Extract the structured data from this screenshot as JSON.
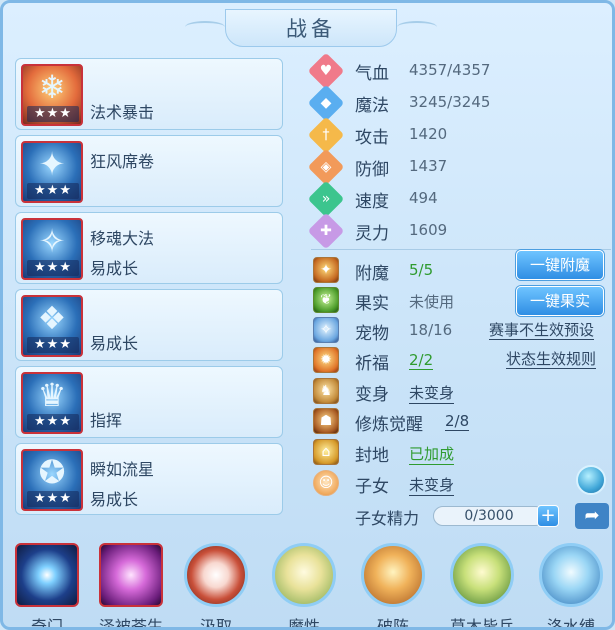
{
  "title": "战备",
  "skills": [
    {
      "name": "",
      "extra": "法术暴击",
      "stars": "★★★",
      "glyph": "❄"
    },
    {
      "name": "狂风席卷",
      "extra": "",
      "stars": "★★★",
      "glyph": "✦"
    },
    {
      "name": "移魂大法",
      "extra": "易成长",
      "stars": "★★★",
      "glyph": "✧"
    },
    {
      "name": "",
      "extra": "易成长",
      "stars": "★★★",
      "glyph": "❖"
    },
    {
      "name": "",
      "extra": "指挥",
      "stars": "★★★",
      "glyph": "♛"
    },
    {
      "name": "瞬如流星",
      "extra": "易成长",
      "stars": "★★★",
      "glyph": "✪"
    }
  ],
  "stats": [
    {
      "label": "气血",
      "value": "4357/4357",
      "icon": "heart-icon",
      "color": "#f07a8a",
      "glyph": "♥"
    },
    {
      "label": "魔法",
      "value": "3245/3245",
      "icon": "mana-icon",
      "color": "#5aaef0",
      "glyph": "◆"
    },
    {
      "label": "攻击",
      "value": "1420",
      "icon": "sword-icon",
      "color": "#f5b94a",
      "glyph": "†"
    },
    {
      "label": "防御",
      "value": "1437",
      "icon": "shield-icon",
      "color": "#f29a5a",
      "glyph": "◈"
    },
    {
      "label": "速度",
      "value": "494",
      "icon": "speed-icon",
      "color": "#3cc58e",
      "glyph": "»"
    },
    {
      "label": "灵力",
      "value": "1609",
      "icon": "spirit-icon",
      "color": "#c79ae6",
      "glyph": "✚"
    }
  ],
  "attrs": [
    {
      "label": "附魔",
      "value": "5/5",
      "style": "green",
      "glyph": "✦"
    },
    {
      "label": "果实",
      "value": "未使用",
      "style": "plain",
      "glyph": "❦"
    },
    {
      "label": "宠物",
      "value": "18/16",
      "style": "plain",
      "glyph": "✧"
    },
    {
      "label": "祈福",
      "value": "2/2",
      "style": "green-link",
      "glyph": "✹"
    },
    {
      "label": "变身",
      "value": "未变身",
      "style": "link",
      "glyph": "♞"
    },
    {
      "label": "修炼觉醒",
      "value": "2/8",
      "style": "link",
      "glyph": "☗"
    },
    {
      "label": "封地",
      "value": "已加成",
      "style": "green-link",
      "glyph": "⌂"
    },
    {
      "label": "子女",
      "value": "未变身",
      "style": "link",
      "glyph": "☺"
    }
  ],
  "buttons": {
    "enchant_all": "一键附魔",
    "fruit_all": "一键果实"
  },
  "links": {
    "event_preset": "赛事不生效预设",
    "status_rules": "状态生效规则"
  },
  "energy": {
    "label": "子女精力",
    "value": "0/3000",
    "plus": "+"
  },
  "bottom": [
    {
      "label": "奇门",
      "shape": "square"
    },
    {
      "label": "泽被苍生",
      "shape": "square"
    },
    {
      "label": "汲取",
      "shape": "round"
    },
    {
      "label": "魔性",
      "shape": "round"
    },
    {
      "label": "破阵",
      "shape": "round"
    },
    {
      "label": "草木皆兵",
      "shape": "round"
    },
    {
      "label": "洛水缚",
      "shape": "round"
    }
  ]
}
